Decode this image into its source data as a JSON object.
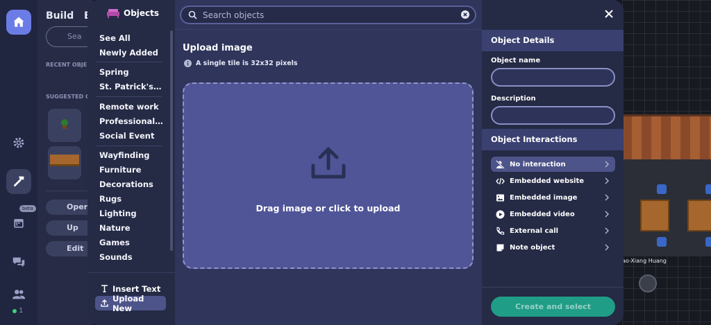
{
  "background": {
    "build_title": "Build",
    "build_title_second": "E",
    "search_placeholder": "Sea",
    "recent_label": "RECENT OBJE",
    "suggested_label": "SUGGESTED O",
    "buttons": [
      "Oper",
      "Up",
      "Edit"
    ],
    "beta_badge": "beta",
    "online_count": "1",
    "map_name_tag": "ao-Xiang Huang"
  },
  "categories": {
    "header": "Objects",
    "items": [
      {
        "label": "See All"
      },
      {
        "label": "Newly Added"
      },
      {
        "label": "Spring"
      },
      {
        "label": "St. Patrick's Day"
      },
      {
        "label": "Remote work"
      },
      {
        "label": "Professional Ev..."
      },
      {
        "label": "Social Event"
      },
      {
        "label": "Wayfinding"
      },
      {
        "label": "Furniture"
      },
      {
        "label": "Decorations"
      },
      {
        "label": "Rugs"
      },
      {
        "label": "Lighting"
      },
      {
        "label": "Nature"
      },
      {
        "label": "Games"
      },
      {
        "label": "Sounds"
      }
    ],
    "insert_text": "Insert Text",
    "upload_new": "Upload New"
  },
  "search": {
    "placeholder": "Search objects"
  },
  "upload": {
    "title": "Upload image",
    "hint": "A single tile is 32x32 pixels",
    "drop_text": "Drag image or click to upload"
  },
  "details": {
    "section_title": "Object Details",
    "name_label": "Object name",
    "name_value": "",
    "description_label": "Description",
    "description_value": "",
    "interactions_title": "Object Interactions",
    "interactions": [
      {
        "label": "No interaction",
        "icon": "person-off-icon"
      },
      {
        "label": "Embedded website",
        "icon": "code-icon"
      },
      {
        "label": "Embedded image",
        "icon": "image-icon"
      },
      {
        "label": "Embedded video",
        "icon": "play-icon"
      },
      {
        "label": "External call",
        "icon": "phone-icon"
      },
      {
        "label": "Note object",
        "icon": "note-icon"
      }
    ],
    "create_button": "Create and select"
  },
  "colors": {
    "accent": "#4d5489",
    "create_button": "#1f9d87",
    "dropzone": "#4f5597"
  }
}
